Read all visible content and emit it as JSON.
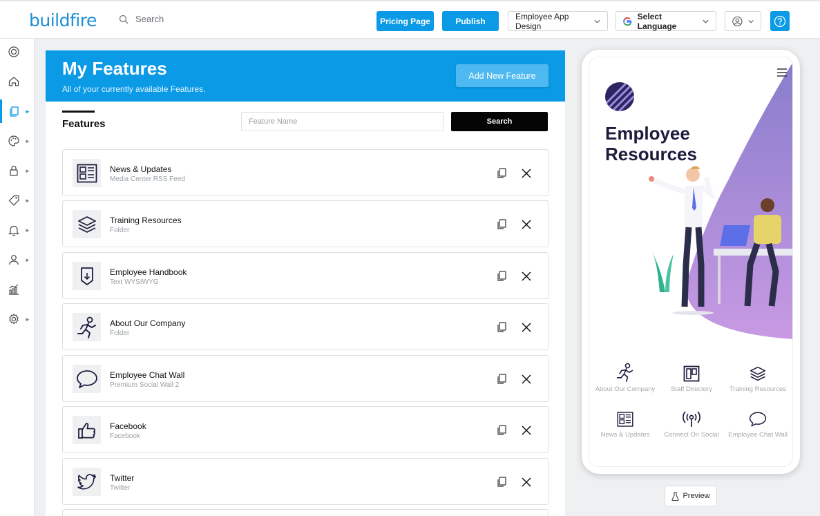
{
  "brand": {
    "logo_a": "build",
    "logo_b": "fire"
  },
  "topbar": {
    "search_placeholder": "Search",
    "pricing_label": "Pricing Page",
    "publish_label": "Publish",
    "app_select": "Employee App Design",
    "language_select": "Select Language"
  },
  "sidebar": {
    "items": [
      {
        "icon": "lifebuoy-icon",
        "arrow": false
      },
      {
        "icon": "home-icon",
        "arrow": false
      },
      {
        "icon": "pages-icon",
        "arrow": true,
        "active": true
      },
      {
        "icon": "palette-icon",
        "arrow": true
      },
      {
        "icon": "lock-icon",
        "arrow": true
      },
      {
        "icon": "tag-icon",
        "arrow": true
      },
      {
        "icon": "bell-icon",
        "arrow": true
      },
      {
        "icon": "user-icon",
        "arrow": true
      },
      {
        "icon": "analytics-icon",
        "arrow": false
      },
      {
        "icon": "gear-icon",
        "arrow": true
      }
    ]
  },
  "main": {
    "title": "My Features",
    "subtitle": "All of your currently available Features.",
    "add_button": "Add New Feature",
    "tab": "Features",
    "feature_name_placeholder": "Feature Name",
    "search_button": "Search",
    "features": [
      {
        "title": "News & Updates",
        "sub": "Media Center RSS Feed",
        "icon": "news-icon"
      },
      {
        "title": "Training Resources",
        "sub": "Folder",
        "icon": "layers-icon"
      },
      {
        "title": "Employee Handbook",
        "sub": "Text WYSIWYG",
        "icon": "document-icon"
      },
      {
        "title": "About Our Company",
        "sub": "Folder",
        "icon": "runner-icon"
      },
      {
        "title": "Employee Chat Wall",
        "sub": "Premium Social Wall 2",
        "icon": "chat-bubble-icon"
      },
      {
        "title": "Facebook",
        "sub": "Facebook",
        "icon": "thumbs-up-icon"
      },
      {
        "title": "Twitter",
        "sub": "Twitter",
        "icon": "twitter-bird-icon"
      }
    ]
  },
  "phone": {
    "app_title": "Employee\nResources",
    "grid": [
      {
        "label": "About Our Company",
        "icon": "runner-icon"
      },
      {
        "label": "Staff Directory",
        "icon": "directory-icon"
      },
      {
        "label": "Training Resources",
        "icon": "layers-icon"
      },
      {
        "label": "News & Updates",
        "icon": "news-icon"
      },
      {
        "label": "Connect On Social",
        "icon": "broadcast-icon"
      },
      {
        "label": "Employee Chat Wall",
        "icon": "chat-bubble-icon"
      }
    ],
    "preview_label": "Preview"
  },
  "colors": {
    "accent": "#0b9ae6",
    "dark": "#1e1c3d",
    "purple": "#9a7ed0"
  }
}
